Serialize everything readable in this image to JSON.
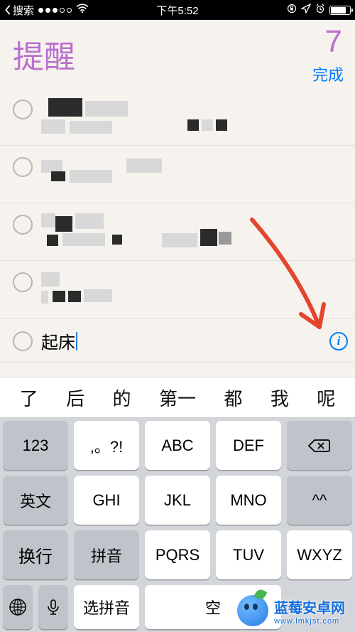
{
  "status_bar": {
    "back_label": "搜索",
    "time": "下午5:52"
  },
  "header": {
    "title": "提醒",
    "count": "7",
    "done": "完成"
  },
  "active_row": {
    "text": "起床"
  },
  "candidates": [
    "了",
    "后",
    "的",
    "第一",
    "都",
    "我",
    "呢"
  ],
  "kbd": {
    "r1": [
      "123",
      ",。?!",
      "ABC",
      "DEF"
    ],
    "r2": [
      "英文",
      "GHI",
      "JKL",
      "MNO",
      "^^"
    ],
    "r3": [
      "拼音",
      "PQRS",
      "TUV",
      "WXYZ"
    ],
    "enter": "换行",
    "bottom": {
      "select_pinyin": "选拼音",
      "space": "空"
    }
  },
  "watermark": {
    "name": "蓝莓安卓网",
    "url": "www.lmkjst.com"
  }
}
